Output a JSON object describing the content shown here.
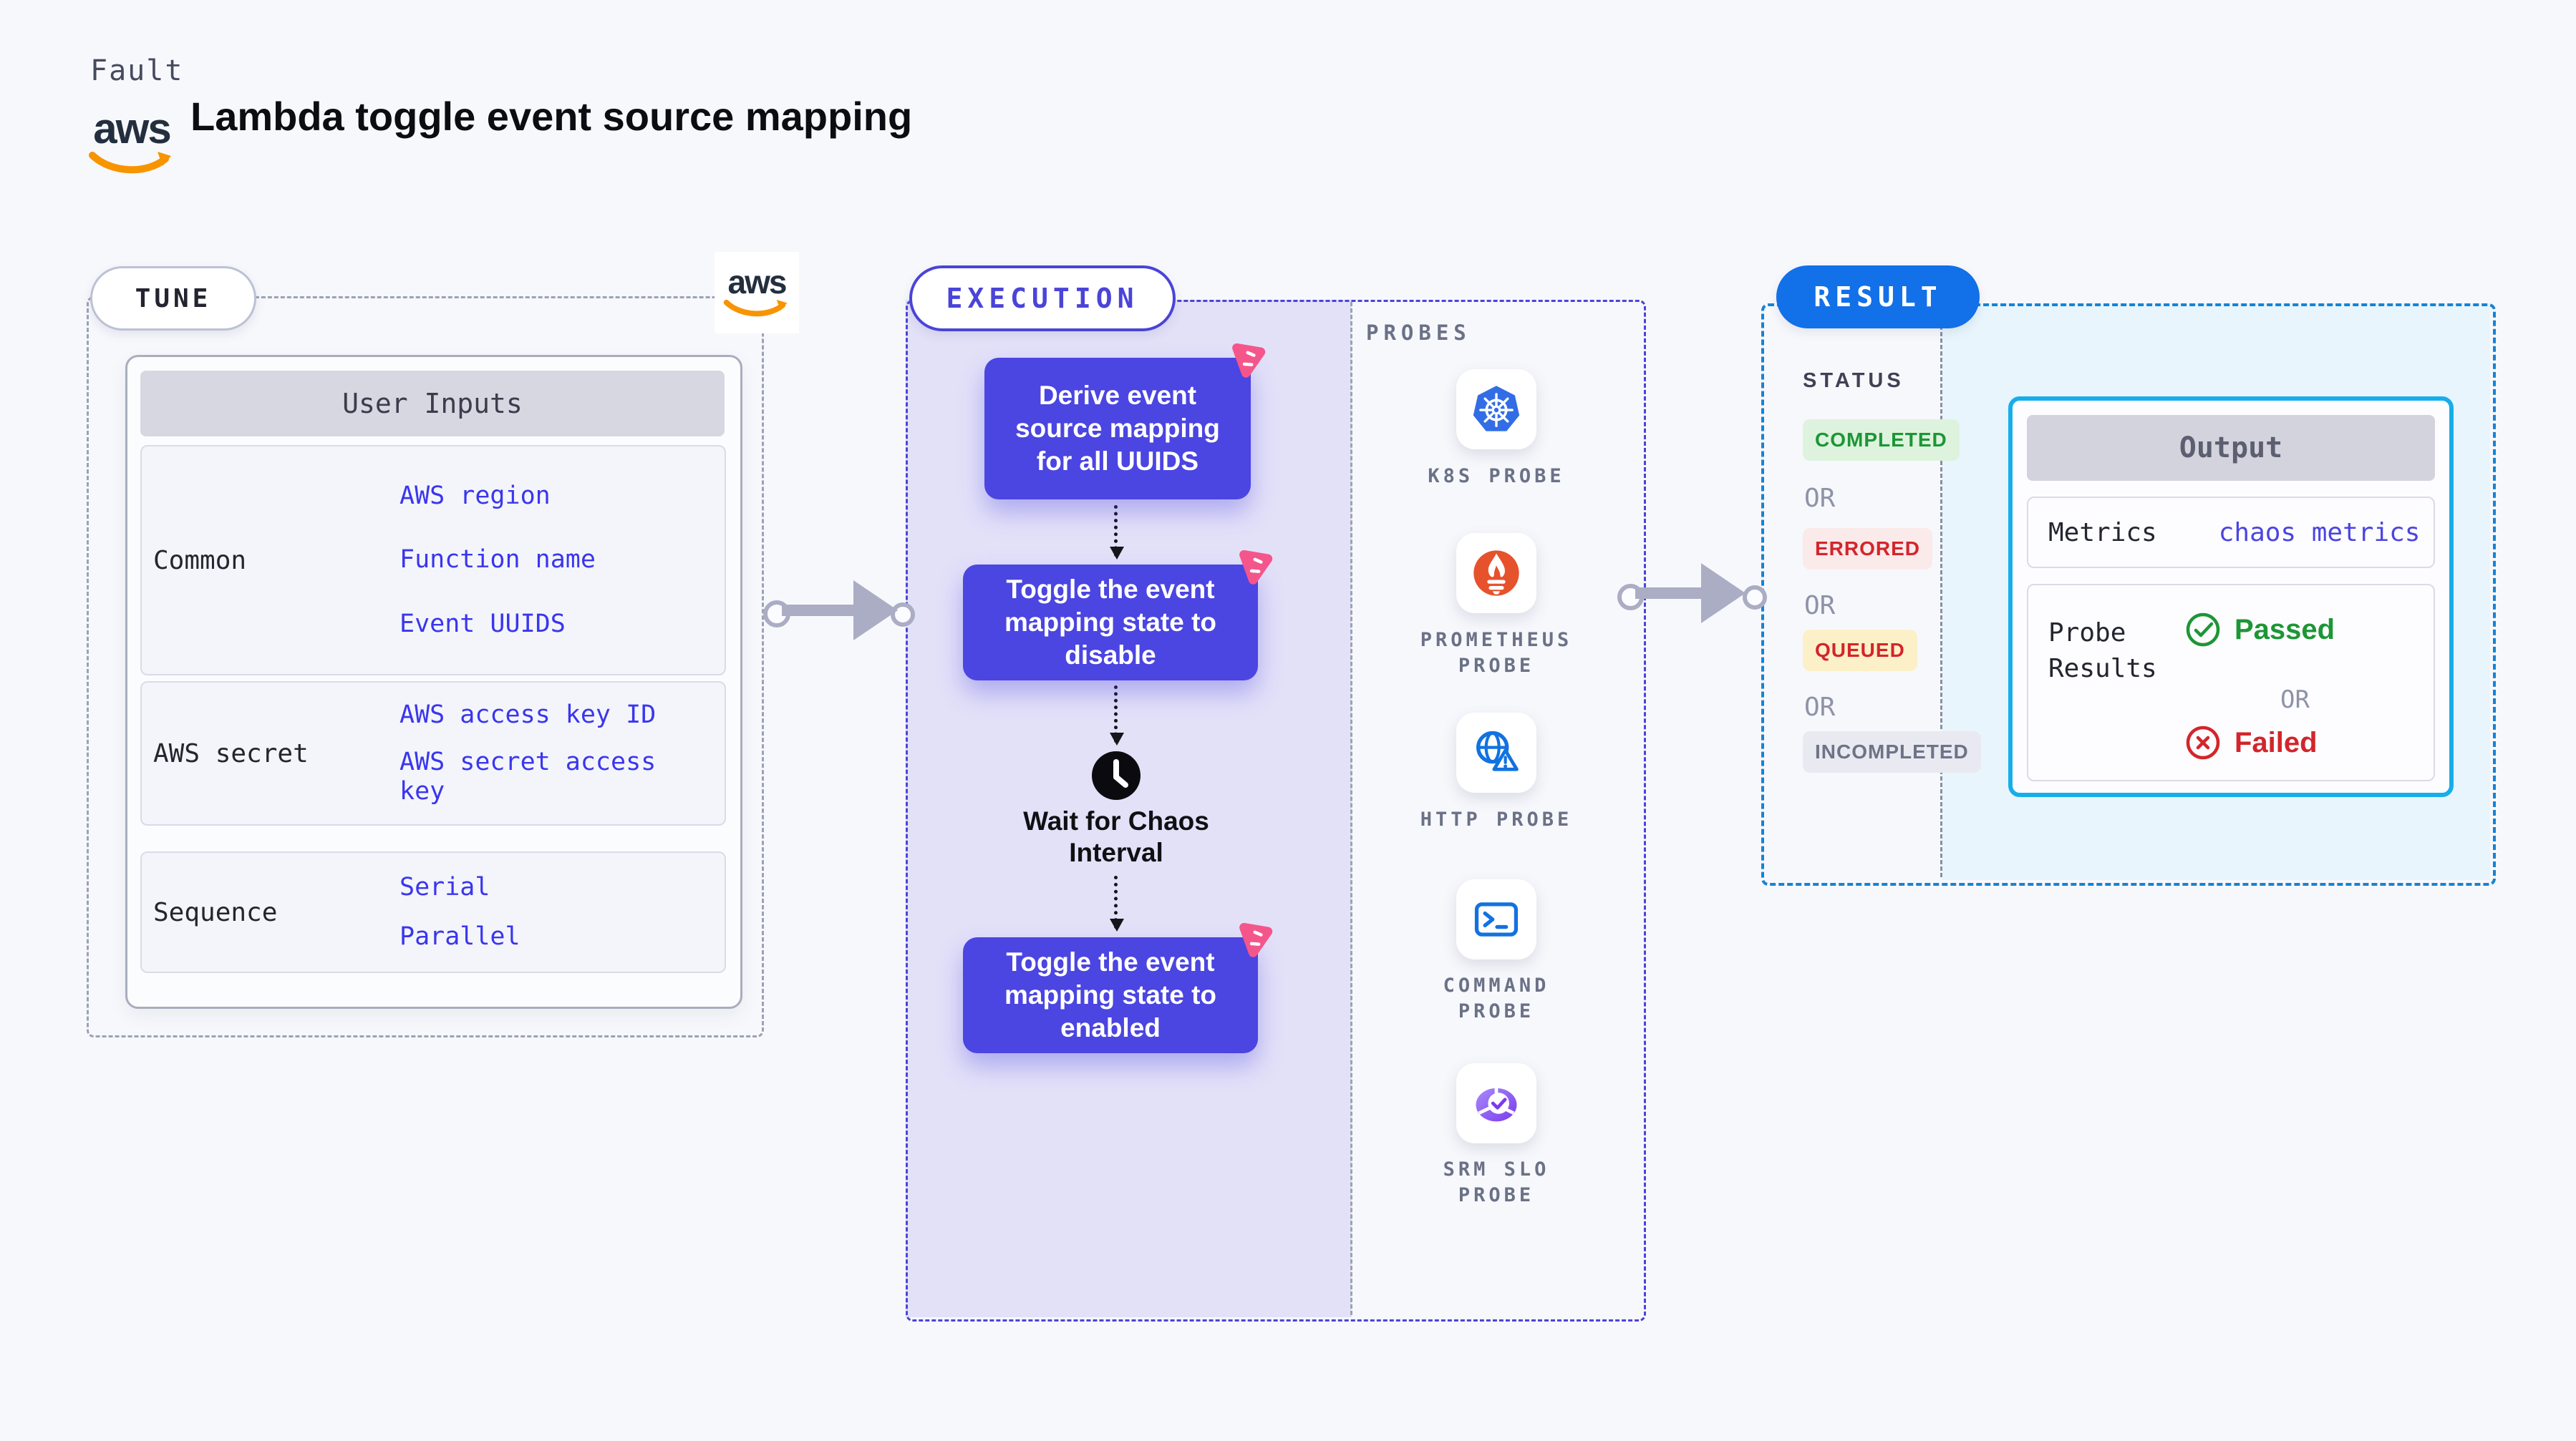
{
  "header": {
    "eyebrow": "Fault",
    "title": "Lambda toggle event source mapping",
    "aws_wordmark": "aws"
  },
  "tune": {
    "badge": "TUNE",
    "aws_wordmark": "aws",
    "user_inputs": {
      "title": "User Inputs",
      "rows": [
        {
          "label": "Common",
          "links": [
            "AWS region",
            "Function name",
            "Event UUIDS"
          ]
        },
        {
          "label": "AWS secret",
          "links": [
            "AWS access key ID",
            "AWS secret access key"
          ]
        },
        {
          "label": "Sequence",
          "links": [
            "Serial",
            "Parallel"
          ]
        }
      ]
    }
  },
  "execution": {
    "badge": "EXECUTION",
    "steps": [
      "Derive event source mapping for all UUIDS",
      "Toggle the event mapping state to disable",
      "Toggle the event mapping state to enabled"
    ],
    "wait_label": "Wait for Chaos Interval"
  },
  "probes": {
    "title": "PROBES",
    "items": [
      {
        "label": "K8S PROBE",
        "icon": "kubernetes-icon"
      },
      {
        "label": "PROMETHEUS PROBE",
        "icon": "prometheus-icon"
      },
      {
        "label": "HTTP PROBE",
        "icon": "http-globe-warning-icon"
      },
      {
        "label": "COMMAND PROBE",
        "icon": "terminal-icon"
      },
      {
        "label": "SRM SLO PROBE",
        "icon": "srm-slo-donut-check-icon"
      }
    ]
  },
  "result": {
    "badge": "RESULT",
    "status": {
      "title": "STATUS",
      "or": "OR",
      "badges": [
        {
          "label": "COMPLETED",
          "fg": "#1d9636",
          "bg": "#def3de"
        },
        {
          "label": "ERRORED",
          "fg": "#d3252b",
          "bg": "#fbeaea"
        },
        {
          "label": "QUEUED",
          "fg": "#d3252b",
          "bg": "#fcf0c8"
        },
        {
          "label": "INCOMPLETED",
          "fg": "#6e7387",
          "bg": "#e9eaf1"
        }
      ]
    },
    "output": {
      "title": "Output",
      "metrics_label": "Metrics",
      "metrics_value": "chaos metrics",
      "probe_results_label": "Probe Results",
      "passed_label": "Passed",
      "or_label": "OR",
      "failed_label": "Failed"
    }
  },
  "colors": {
    "indigo": "#4b45e1",
    "execution_bg": "#e3e1f8",
    "link_blue": "#3a36ee",
    "result_blue": "#1270e8",
    "result_dash": "#1583d6",
    "output_border": "#16aeea",
    "passed_green": "#1d9636",
    "failed_red": "#d3252b",
    "chaos_pink": "#f4568c",
    "aws_orange": "#f79400",
    "k8s_blue": "#326de6",
    "prometheus_orange": "#e6522c",
    "http_blue": "#1272e0",
    "srm_purple": "#7c3aed"
  }
}
